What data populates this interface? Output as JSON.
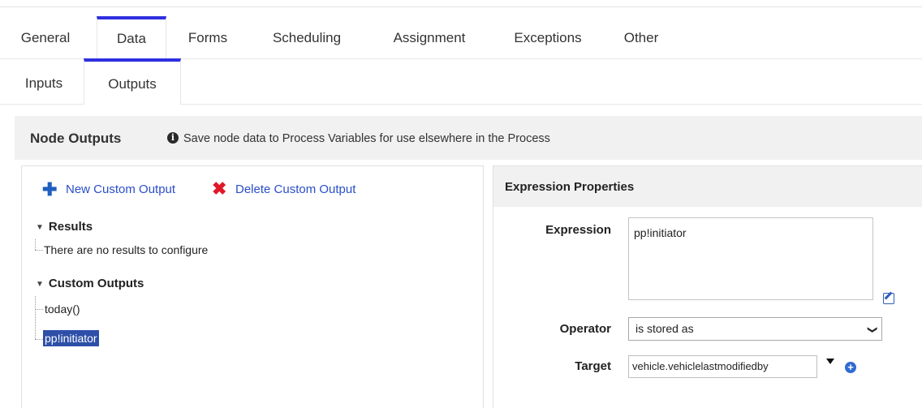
{
  "tabs_primary": [
    {
      "label": "General"
    },
    {
      "label": "Data",
      "active": true
    },
    {
      "label": "Forms"
    },
    {
      "label": "Scheduling"
    },
    {
      "label": "Assignment"
    },
    {
      "label": "Exceptions"
    },
    {
      "label": "Other"
    }
  ],
  "tabs_secondary": [
    {
      "label": "Inputs"
    },
    {
      "label": "Outputs",
      "active": true
    }
  ],
  "node_outputs": {
    "title": "Node Outputs",
    "info_icon": "info-circle-icon",
    "description": "Save node data to Process Variables for use elsewhere in the Process"
  },
  "left_panel": {
    "new_output_label": "New Custom Output",
    "new_output_icon": "plus-icon",
    "delete_output_label": "Delete Custom Output",
    "delete_output_icon": "x-icon",
    "results": {
      "title": "Results",
      "empty_text": "There are no results to configure"
    },
    "custom_outputs": {
      "title": "Custom Outputs",
      "items": [
        "today()",
        "pp!initiator"
      ],
      "selected": "pp!initiator"
    }
  },
  "expression_properties": {
    "title": "Expression Properties",
    "expression_label": "Expression",
    "expression_value": "pp!initiator",
    "operator_label": "Operator",
    "operator_value": "is stored as",
    "target_label": "Target",
    "target_value": "vehicle.vehiclelastmodifiedby"
  },
  "colors": {
    "active_tab_accent": "#2f2fe0",
    "link": "#2a4ec7",
    "selected_bg": "#2d4fa8",
    "delete_icon": "#e0182a"
  }
}
